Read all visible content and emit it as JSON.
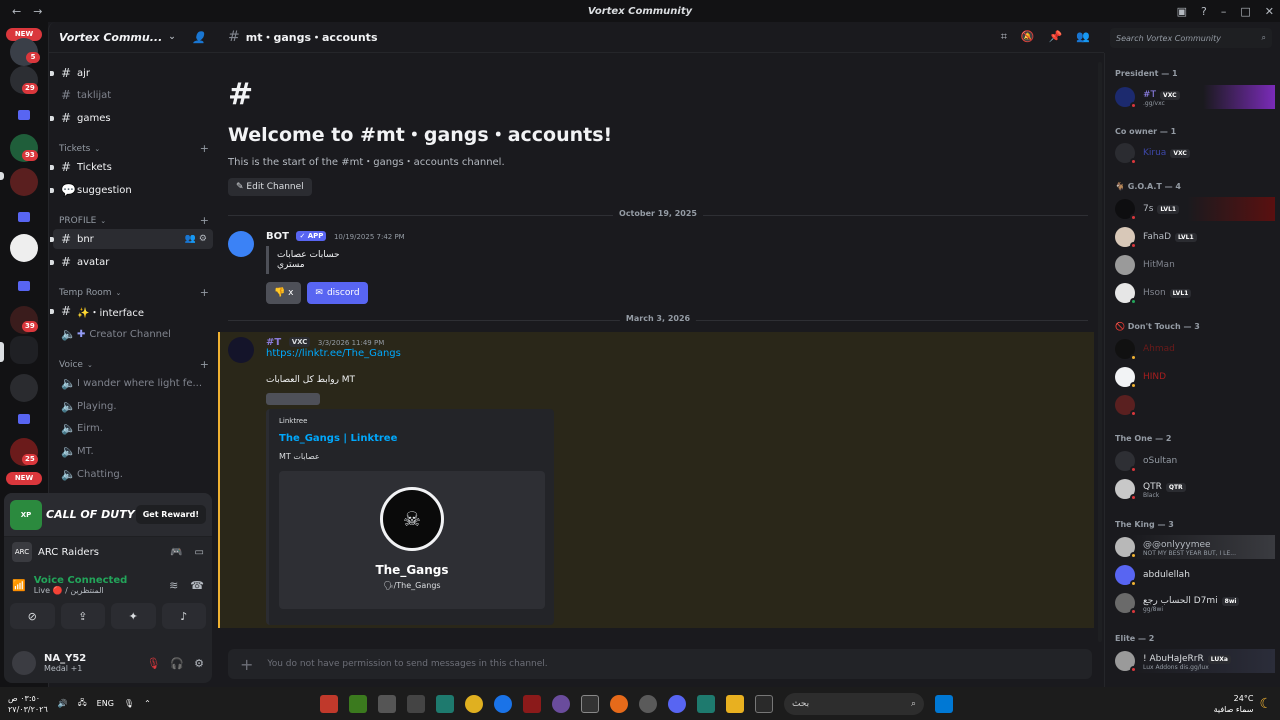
{
  "window": {
    "title": "Vortex Community",
    "back_icon": "arrow-left-icon",
    "forward_icon": "arrow-right-icon"
  },
  "rail": {
    "badges": [
      "5",
      "29",
      "93",
      "39",
      "25"
    ],
    "new_label": "NEW"
  },
  "server": {
    "name": "Vortex Commu..."
  },
  "channels": [
    {
      "id": "ajr",
      "label": "ajr",
      "type": "text",
      "unread": true
    },
    {
      "id": "taklijat",
      "label": "taklijat",
      "type": "text",
      "unread": false
    },
    {
      "id": "games",
      "label": "games",
      "type": "text",
      "unread": true
    },
    {
      "id": "tickets",
      "label": "Tickets",
      "type": "text",
      "unread": true
    },
    {
      "id": "suggestion",
      "label": "suggestion",
      "type": "forum",
      "unread": true
    },
    {
      "id": "bnr",
      "label": "bnr",
      "type": "text",
      "unread": true,
      "hover": true
    },
    {
      "id": "avatar",
      "label": "avatar",
      "type": "text",
      "unread": true
    },
    {
      "id": "interface",
      "label": "✨・interface",
      "type": "text",
      "unread": true
    },
    {
      "id": "creator",
      "label": "Creator Channel",
      "type": "plus",
      "unread": false
    },
    {
      "id": "wander",
      "label": "I wander where light fe...",
      "type": "voice",
      "unread": false
    },
    {
      "id": "playing",
      "label": "Playing.",
      "type": "voice",
      "unread": false
    },
    {
      "id": "eirm",
      "label": "Eirm.",
      "type": "voice",
      "unread": false
    },
    {
      "id": "mt",
      "label": "MT.",
      "type": "voice",
      "unread": false
    },
    {
      "id": "chatting",
      "label": "Chatting.",
      "type": "voice",
      "unread": false
    }
  ],
  "categories": [
    {
      "id": "tickets",
      "label": "Tickets"
    },
    {
      "id": "profile",
      "label": "PROFILE"
    },
    {
      "id": "temp",
      "label": "Temp Room"
    },
    {
      "id": "voice",
      "label": "Voice"
    }
  ],
  "promo": {
    "title": "CALL OF DUTY",
    "logo": "XP",
    "button": "Get Reward!"
  },
  "activity": {
    "name": "ARC Raiders",
    "icon_label": "ARC"
  },
  "voice": {
    "status": "Voice Connected",
    "sub": "Live 🔴 / المنتظرين"
  },
  "user": {
    "name": "NA_Y52",
    "status": "Medal +1"
  },
  "channel_header": {
    "name": "mt・gangs・accounts"
  },
  "welcome": {
    "title": "Welcome to #mt・gangs・accounts!",
    "subtitle": "This is the start of the #mt・gangs・accounts channel.",
    "edit_button": "Edit Channel"
  },
  "dividers": [
    "October 19, 2025",
    "March 3, 2026"
  ],
  "messages": [
    {
      "author": "BOT",
      "tag": "✓ APP",
      "time": "10/19/2025 7:42 PM",
      "quote": "حسابات عصابات مستري",
      "buttons": [
        "x",
        "discord"
      ]
    },
    {
      "author": "#T",
      "tag": "VXC",
      "time": "3/3/2026 11:49 PM",
      "link": "https://linktr.ee/The_Gangs",
      "text": "روابط كل العصابات MT",
      "embed": {
        "provider": "Linktree",
        "title": "The_Gangs | Linktree",
        "description": "MT عصابات",
        "name": "The_Gangs",
        "handle": "🗣/The_Gangs"
      }
    }
  ],
  "composer": {
    "placeholder": "You do not have permission to send messages in this channel."
  },
  "search": {
    "placeholder": "Search Vortex Community"
  },
  "roles": [
    {
      "label": "President — 1"
    },
    {
      "label": "Co owner — 1"
    },
    {
      "label": "🐐 G.O.A.T — 4"
    },
    {
      "label": "🚫 Don't Touch — 3"
    },
    {
      "label": "The One — 2"
    },
    {
      "label": "The King — 3"
    },
    {
      "label": "Elite — 2"
    }
  ],
  "members": [
    {
      "name": "#T",
      "sub": ".gg/vxc",
      "tag": "VXC",
      "color": "#9b8cff"
    },
    {
      "name": "Kirua",
      "sub": "",
      "tag": "VXC",
      "color": "#5865f2"
    },
    {
      "name": "7s",
      "sub": "",
      "tag": "LVL1",
      "color": "#b5bac1"
    },
    {
      "name": "FahaD",
      "sub": "",
      "tag": "LVL1",
      "color": "#b5bac1"
    },
    {
      "name": "HitMan",
      "sub": "",
      "tag": "",
      "color": "#b5bac1"
    },
    {
      "name": "Hson",
      "sub": "",
      "tag": "LVL1",
      "color": "#b5bac1"
    },
    {
      "name": "Ahmad",
      "sub": "",
      "tag": "",
      "color": "#da373c"
    },
    {
      "name": "HIND",
      "sub": "",
      "tag": "",
      "color": "#da373c"
    },
    {
      "name": "",
      "sub": "",
      "tag": "",
      "color": "#da373c"
    },
    {
      "name": "oSultan",
      "sub": "",
      "tag": "",
      "color": "#b5bac1"
    },
    {
      "name": "QTR",
      "sub": "Black",
      "tag": "QTR",
      "color": "#dbdee1"
    },
    {
      "name": "@@onlyyymee",
      "sub": "NOT MY BEST YEAR BUT, I LE...",
      "tag": "",
      "color": "#b5bac1"
    },
    {
      "name": "abdulellah",
      "sub": "",
      "tag": "",
      "color": "#dbdee1"
    },
    {
      "name": "الحساب رجع D7mi",
      "sub": "gg/8wi",
      "tag": "8wi",
      "color": "#dbdee1"
    },
    {
      "name": "! AbuHaJeRrR",
      "sub": "Lux Addons dis.gg/lux",
      "tag": "LUXa",
      "color": "#dbdee1"
    }
  ],
  "taskbar": {
    "time": "٠٣:٥٠ ص",
    "date": "٢٧/٠٣/٢٠٢٦",
    "lang": "ENG",
    "search_placeholder": "بحث",
    "weather_temp": "24°C",
    "weather_desc": "سماء صافية"
  }
}
